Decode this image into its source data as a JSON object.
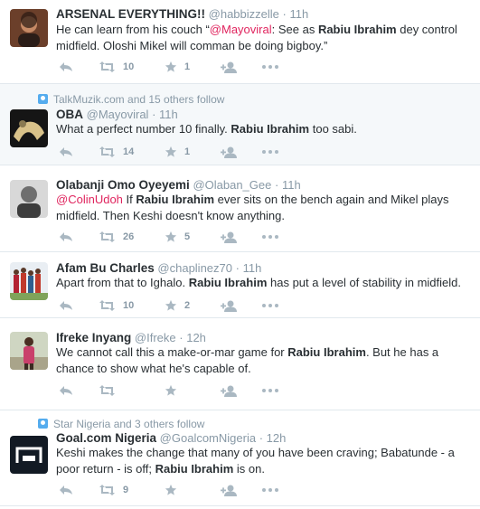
{
  "colors": {
    "icon_gray": "#aab8c2",
    "meta_gray": "#8899a6",
    "mention": "#e0245e",
    "context_blue": "#55acee",
    "highlight_bg": "#f5f8fa",
    "divider": "#e1e8ed"
  },
  "icons": {
    "reply": "reply-icon",
    "retweet": "retweet-icon",
    "favorite": "star-icon",
    "follow": "follow-icon",
    "more": "more-icon",
    "context": "people-icon"
  },
  "tweets": [
    {
      "fullname": "ARSENAL EVERYTHING!!",
      "handle": "@habbizzelle",
      "time": "11h",
      "text": [
        {
          "t": "He can learn from his couch  “"
        },
        {
          "t": "@Mayoviral",
          "m": true
        },
        {
          "t": ": See as "
        },
        {
          "t": "Rabiu Ibrahim",
          "b": true
        },
        {
          "t": " dey control midfield. Oloshi Mikel will comman be doing bigboy.”"
        }
      ],
      "retweets": "10",
      "favorites": "1"
    },
    {
      "context": "TalkMuzik.com and 15 others follow",
      "fullname": "OBA",
      "handle": "@Mayoviral",
      "time": "11h",
      "text": [
        {
          "t": "What a perfect number 10 finally. "
        },
        {
          "t": "Rabiu Ibrahim",
          "b": true
        },
        {
          "t": " too sabi."
        }
      ],
      "retweets": "14",
      "favorites": "1"
    },
    {
      "fullname": "Olabanji Omo Oyeyemi",
      "handle": "@Olaban_Gee",
      "time": "11h",
      "text": [
        {
          "t": "@ColinUdoh",
          "m": true
        },
        {
          "t": " If "
        },
        {
          "t": "Rabiu Ibrahim",
          "b": true
        },
        {
          "t": " ever sits on the bench again and Mikel plays midfield. Then Keshi doesn't know anything."
        }
      ],
      "retweets": "26",
      "favorites": "5"
    },
    {
      "fullname": "Afam Bu Charles",
      "handle": "@chaplinez70",
      "time": "11h",
      "text": [
        {
          "t": "Apart from that to Ighalo. "
        },
        {
          "t": "Rabiu Ibrahim",
          "b": true
        },
        {
          "t": " has put a level of stability in midfield."
        }
      ],
      "retweets": "10",
      "favorites": "2"
    },
    {
      "fullname": "Ifreke Inyang",
      "handle": "@Ifreke",
      "time": "12h",
      "text": [
        {
          "t": "We cannot call this a make-or-mar game for "
        },
        {
          "t": "Rabiu Ibrahim",
          "b": true
        },
        {
          "t": ". But he has a chance to show what he's capable of."
        }
      ],
      "retweets": "",
      "favorites": ""
    },
    {
      "context": "Star Nigeria and 3 others follow",
      "fullname": "Goal.com Nigeria",
      "handle": "@GoalcomNigeria",
      "time": "12h",
      "text": [
        {
          "t": "Keshi makes the change that many of you have been craving; Babatunde - a poor return - is off; "
        },
        {
          "t": "Rabiu Ibrahim",
          "b": true
        },
        {
          "t": " is on."
        }
      ],
      "retweets": "9",
      "favorites": ""
    }
  ]
}
